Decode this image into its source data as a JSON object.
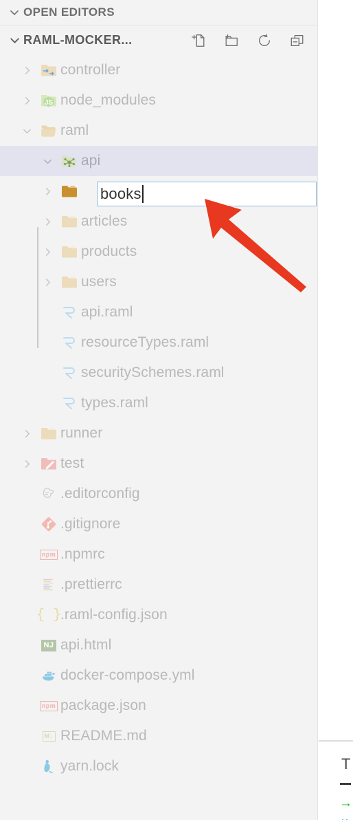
{
  "app": {
    "accent_selection": "#e2e3ef",
    "sidebar_bg": "#f3f3f3",
    "text_color": "#b9b9b9",
    "annotation_arrow_color": "#e8381f",
    "input_border_color": "#8cb9e0"
  },
  "sections": {
    "open_editors": {
      "title": "OPEN EDITORS",
      "twisty": "chevron-down-icon"
    },
    "explorer": {
      "title": "RAML-MOCKER...",
      "twisty": "chevron-down-icon",
      "actions": [
        {
          "name": "new-file-icon",
          "label": "New File"
        },
        {
          "name": "new-folder-icon",
          "label": "New Folder"
        },
        {
          "name": "refresh-icon",
          "label": "Refresh Explorer"
        },
        {
          "name": "collapse-all-icon",
          "label": "Collapse Folders in Explorer"
        }
      ]
    }
  },
  "rename": {
    "value": "books",
    "placeholder": "",
    "icon": "folder-icon-active"
  },
  "tree": [
    {
      "label": "controller",
      "depth": 1,
      "type": "folder",
      "chevron": "chevron-right-icon",
      "icon": "folder-controller-icon"
    },
    {
      "label": "node_modules",
      "depth": 1,
      "type": "folder",
      "chevron": "chevron-right-icon",
      "icon": "folder-node-icon"
    },
    {
      "label": "raml",
      "depth": 1,
      "type": "folder",
      "chevron": "chevron-down-icon",
      "icon": "folder-open-icon"
    },
    {
      "label": "api",
      "depth": 2,
      "type": "folder",
      "chevron": "chevron-down-icon",
      "icon": "folder-api-icon",
      "selected": true
    },
    {
      "label": "books",
      "depth": 3,
      "type": "rename",
      "chevron": "chevron-right-icon",
      "icon": "folder-icon-active"
    },
    {
      "label": "articles",
      "depth": 3,
      "type": "folder",
      "chevron": "chevron-right-icon",
      "icon": "folder-icon"
    },
    {
      "label": "products",
      "depth": 3,
      "type": "folder",
      "chevron": "chevron-right-icon",
      "icon": "folder-icon"
    },
    {
      "label": "users",
      "depth": 3,
      "type": "folder",
      "chevron": "chevron-right-icon",
      "icon": "folder-icon"
    },
    {
      "label": "api.raml",
      "depth": 3,
      "type": "file",
      "chevron": "",
      "icon": "raml-icon"
    },
    {
      "label": "resourceTypes.raml",
      "depth": 3,
      "type": "file",
      "chevron": "",
      "icon": "raml-icon"
    },
    {
      "label": "securitySchemes.raml",
      "depth": 3,
      "type": "file",
      "chevron": "",
      "icon": "raml-icon"
    },
    {
      "label": "types.raml",
      "depth": 3,
      "type": "file",
      "chevron": "",
      "icon": "raml-icon"
    },
    {
      "label": "runner",
      "depth": 1,
      "type": "folder",
      "chevron": "chevron-right-icon",
      "icon": "folder-icon"
    },
    {
      "label": "test",
      "depth": 1,
      "type": "folder",
      "chevron": "chevron-right-icon",
      "icon": "folder-test-icon"
    },
    {
      "label": ".editorconfig",
      "depth": 1,
      "type": "file",
      "chevron": "",
      "icon": "editorconfig-icon"
    },
    {
      "label": ".gitignore",
      "depth": 1,
      "type": "file",
      "chevron": "",
      "icon": "git-icon"
    },
    {
      "label": ".npmrc",
      "depth": 1,
      "type": "file",
      "chevron": "",
      "icon": "npm-icon"
    },
    {
      "label": ".prettierrc",
      "depth": 1,
      "type": "file",
      "chevron": "",
      "icon": "prettier-icon"
    },
    {
      "label": ".raml-config.json",
      "depth": 1,
      "type": "file",
      "chevron": "",
      "icon": "json-icon"
    },
    {
      "label": "api.html",
      "depth": 1,
      "type": "file",
      "chevron": "",
      "icon": "nunjucks-icon"
    },
    {
      "label": "docker-compose.yml",
      "depth": 1,
      "type": "file",
      "chevron": "",
      "icon": "docker-icon"
    },
    {
      "label": "package.json",
      "depth": 1,
      "type": "file",
      "chevron": "",
      "icon": "npm-icon"
    },
    {
      "label": "README.md",
      "depth": 1,
      "type": "file",
      "chevron": "",
      "icon": "markdown-icon"
    },
    {
      "label": "yarn.lock",
      "depth": 1,
      "type": "file",
      "chevron": "",
      "icon": "yarn-icon"
    }
  ],
  "editor_strip": {
    "letter": "T",
    "dash": "—",
    "arrow": "→",
    "dots": "··"
  }
}
